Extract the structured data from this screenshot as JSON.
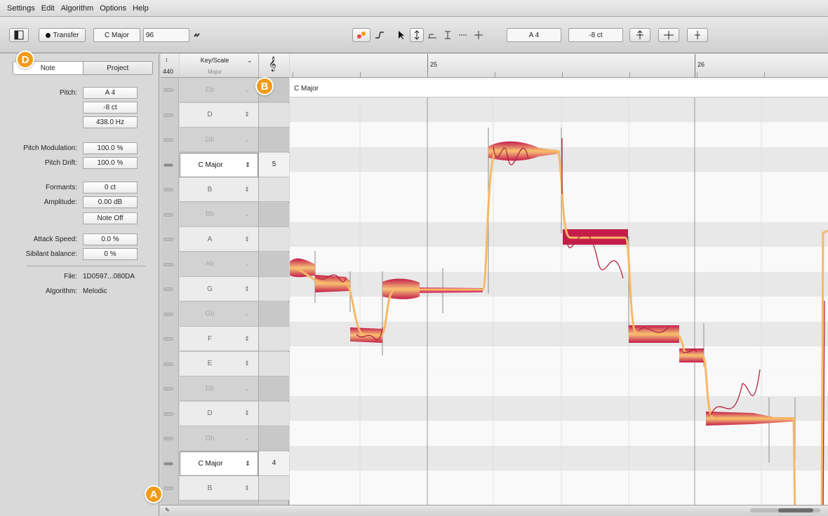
{
  "menu": [
    "Settings",
    "Edit",
    "Algorithm",
    "Options",
    "Help"
  ],
  "toolbar": {
    "transfer_label": "Transfer",
    "key_label": "C Major",
    "tempo_value": "96",
    "pitch_field": "A 4",
    "cent_field": "-8 ct"
  },
  "inspector": {
    "tab_note": "Note",
    "tab_project": "Project",
    "rows": [
      {
        "label": "Pitch:",
        "value": "A 4"
      },
      {
        "label": "",
        "value": "-8 ct"
      },
      {
        "label": "",
        "value": "438.0 Hz"
      },
      {
        "label": "Pitch Modulation:",
        "value": "100.0 %"
      },
      {
        "label": "Pitch Drift:",
        "value": "100.0 %"
      },
      {
        "label": "Formants:",
        "value": "0 ct"
      },
      {
        "label": "Amplitude:",
        "value": "0.00 dB"
      },
      {
        "label": "",
        "value": "Note Off"
      },
      {
        "label": "Attack Speed:",
        "value": "0.0 %"
      },
      {
        "label": "Sibilant balance:",
        "value": "0 %"
      }
    ],
    "file_label": "File:",
    "file_value": "1D0597...080DA",
    "algorithm_label": "Algorithm:",
    "algorithm_value": "Melodic"
  },
  "keyscale": {
    "header_title": "Key/Scale",
    "header_sub": "Major",
    "ref_pitch": "440",
    "rows": [
      {
        "name": "Eb",
        "type": "acc",
        "num": ""
      },
      {
        "name": "D",
        "type": "nat",
        "num": ""
      },
      {
        "name": "Db",
        "type": "acc",
        "num": ""
      },
      {
        "name": "C Major",
        "type": "sel",
        "num": "5"
      },
      {
        "name": "B",
        "type": "nat",
        "num": ""
      },
      {
        "name": "Bb",
        "type": "acc",
        "num": ""
      },
      {
        "name": "A",
        "type": "nat",
        "num": ""
      },
      {
        "name": "Ab",
        "type": "acc",
        "num": ""
      },
      {
        "name": "G",
        "type": "nat",
        "num": ""
      },
      {
        "name": "Gb",
        "type": "acc",
        "num": ""
      },
      {
        "name": "F",
        "type": "nat",
        "num": ""
      },
      {
        "name": "E",
        "type": "nat",
        "num": ""
      },
      {
        "name": "Eb",
        "type": "acc",
        "num": ""
      },
      {
        "name": "D",
        "type": "nat",
        "num": ""
      },
      {
        "name": "Db",
        "type": "acc",
        "num": ""
      },
      {
        "name": "C Major",
        "type": "sel",
        "num": "4"
      },
      {
        "name": "B",
        "type": "nat",
        "num": ""
      }
    ]
  },
  "ruler": {
    "bar1": "25",
    "bar2": "26"
  },
  "key_bar_label": "C Major",
  "badges": {
    "a": "A",
    "b": "B",
    "d": "D"
  },
  "colors": {
    "badge": "#f29b19",
    "blob": "#c51d4a",
    "line": "#f7b865"
  }
}
